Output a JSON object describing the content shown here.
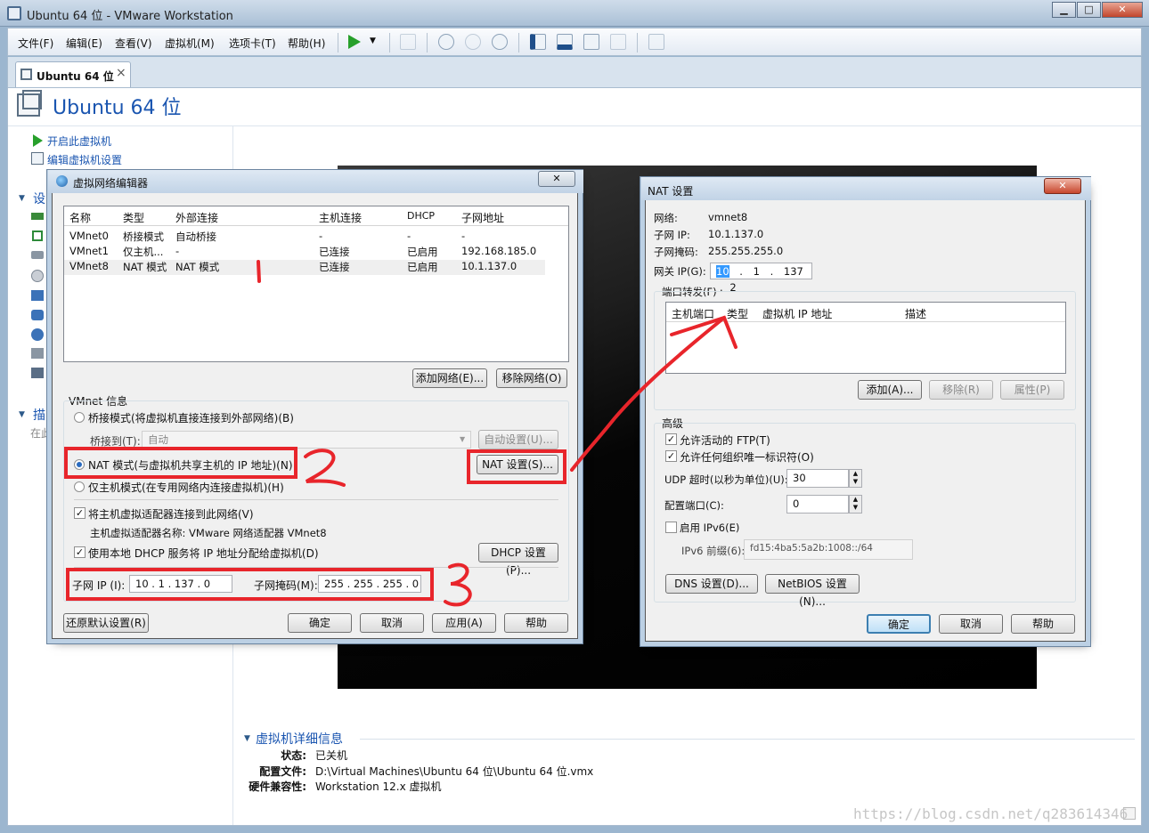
{
  "window": {
    "title": "Ubuntu 64 位 - VMware Workstation",
    "min": "▁",
    "max": "□",
    "close": "✕"
  },
  "menu": [
    "文件(F)",
    "编辑(E)",
    "查看(V)",
    "虚拟机(M)",
    "选项卡(T)",
    "帮助(H)"
  ],
  "toolbar": {
    "play_icon": "play-icon",
    "dropdown": "▼"
  },
  "tab": {
    "label": "Ubuntu 64 位",
    "close": "×"
  },
  "vm": {
    "title": "Ubuntu 64 位",
    "actions": [
      "开启此虚拟机",
      "编辑虚拟机设置"
    ],
    "section_devices": "设",
    "section_desc": "描",
    "desc_placeholder": "在此",
    "details_title": "虚拟机详细信息",
    "details": [
      {
        "k": "状态:",
        "v": "已关机"
      },
      {
        "k": "配置文件:",
        "v": "D:\\Virtual Machines\\Ubuntu 64 位\\Ubuntu 64 位.vmx"
      },
      {
        "k": "硬件兼容性:",
        "v": "Workstation 12.x 虚拟机"
      }
    ]
  },
  "vne": {
    "title": "虚拟网络编辑器",
    "close": "✕",
    "columns": [
      "名称",
      "类型",
      "外部连接",
      "主机连接",
      "DHCP",
      "子网地址"
    ],
    "rows": [
      [
        "VMnet0",
        "桥接模式",
        "自动桥接",
        "-",
        "-",
        "-"
      ],
      [
        "VMnet1",
        "仅主机...",
        "-",
        "已连接",
        "已启用",
        "192.168.185.0"
      ],
      [
        "VMnet8",
        "NAT 模式",
        "NAT 模式",
        "已连接",
        "已启用",
        "10.1.137.0"
      ]
    ],
    "add_network": "添加网络(E)...",
    "remove_network": "移除网络(O)",
    "info_title": "VMnet 信息",
    "bridge_mode": "桥接模式(将虚拟机直接连接到外部网络)(B)",
    "bridge_to_label": "桥接到(T):",
    "bridge_to_value": "自动",
    "auto_settings": "自动设置(U)...",
    "nat_mode": "NAT 模式(与虚拟机共享主机的 IP 地址)(N)",
    "nat_settings": "NAT 设置(S)...",
    "host_only": "仅主机模式(在专用网络内连接虚拟机)(H)",
    "connect_adapter": "将主机虚拟适配器连接到此网络(V)",
    "adapter_name": "主机虚拟适配器名称: VMware 网络适配器 VMnet8",
    "use_dhcp": "使用本地 DHCP 服务将 IP 地址分配给虚拟机(D)",
    "dhcp_settings": "DHCP 设置(P)...",
    "subnet_ip_label": "子网 IP (I):",
    "subnet_ip": "10 . 1 . 137 . 0",
    "subnet_mask_label": "子网掩码(M):",
    "subnet_mask": "255 . 255 . 255 . 0",
    "restore_defaults": "还原默认设置(R)",
    "ok": "确定",
    "cancel": "取消",
    "apply": "应用(A)",
    "help": "帮助"
  },
  "nat": {
    "title": "NAT 设置",
    "close": "✕",
    "network_label": "网络:",
    "network": "vmnet8",
    "subnet_ip_label": "子网 IP:",
    "subnet_ip": "10.1.137.0",
    "subnet_mask_label": "子网掩码:",
    "subnet_mask": "255.255.255.0",
    "gateway_label": "网关 IP(G):",
    "gateway": [
      "10",
      ".",
      "1",
      ".",
      "137",
      ".",
      "2"
    ],
    "port_forwarding": "端口转发(F)",
    "pf_columns": [
      "主机端口",
      "类型",
      "虚拟机 IP 地址",
      "描述"
    ],
    "add": "添加(A)...",
    "remove": "移除(R)",
    "properties": "属性(P)",
    "advanced": "高级",
    "allow_ftp": "允许活动的 FTP(T)",
    "allow_oui": "允许任何组织唯一标识符(O)",
    "udp_timeout_label": "UDP 超时(以秒为单位)(U):",
    "udp_timeout": "30",
    "config_port_label": "配置端口(C):",
    "config_port": "0",
    "enable_ipv6": "启用 IPv6(E)",
    "ipv6_prefix_label": "IPv6 前缀(6):",
    "ipv6_prefix": "fd15:4ba5:5a2b:1008::/64",
    "dns": "DNS 设置(D)...",
    "netbios": "NetBIOS 设置(N)...",
    "ok": "确定",
    "cancel": "取消",
    "help": "帮助"
  },
  "annotations": {
    "n1": "1",
    "n2": "2",
    "n3": "3",
    "color": "#e8252b"
  },
  "watermark": "https://blog.csdn.net/q283614346"
}
